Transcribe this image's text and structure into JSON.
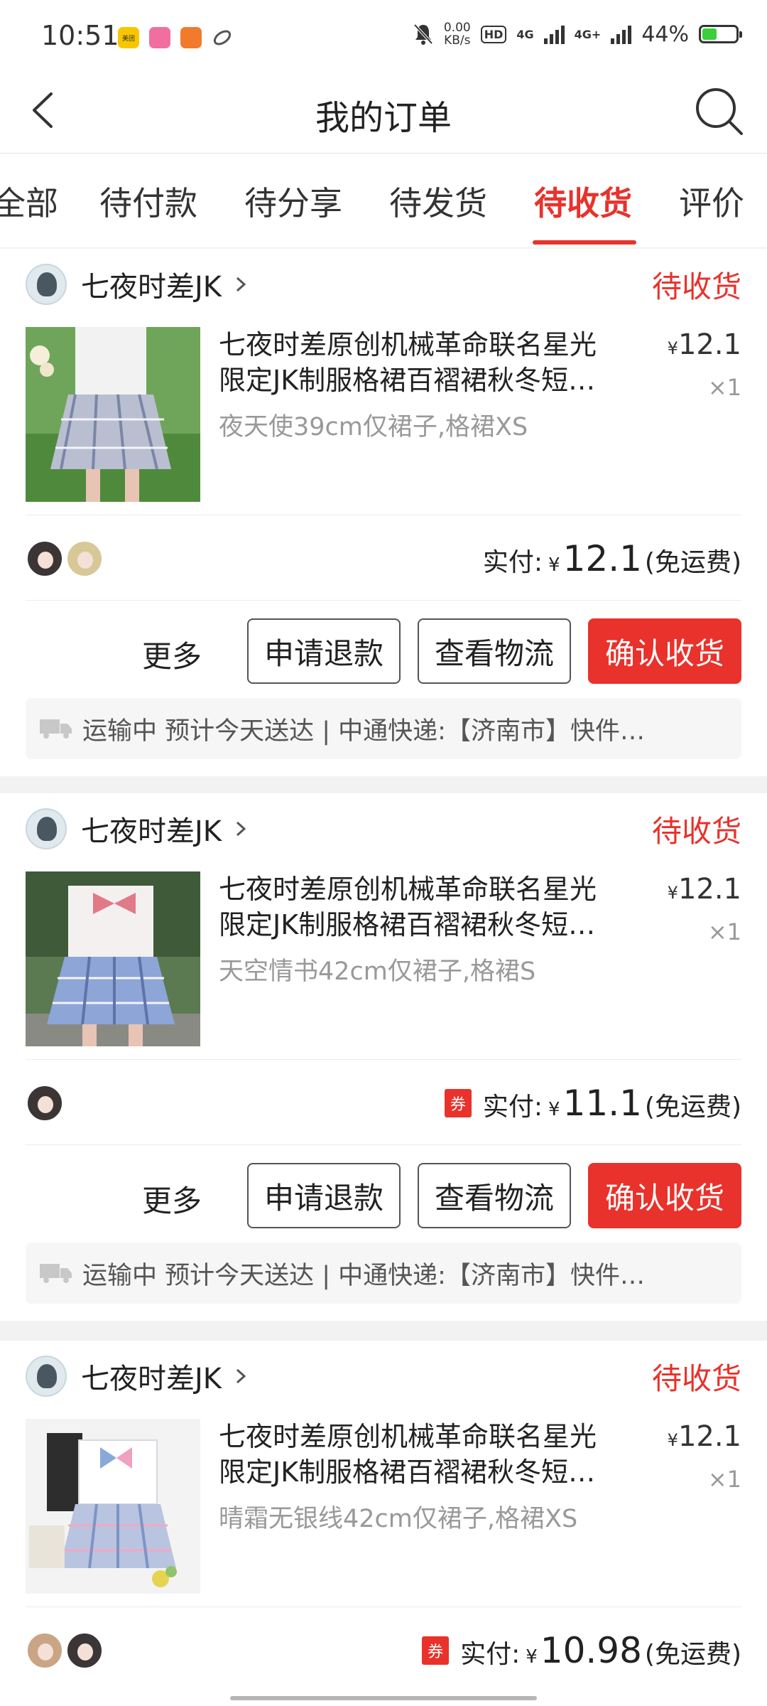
{
  "status_bar": {
    "time": "10:51",
    "net_speed_value": "0.00",
    "net_speed_unit": "KB/s",
    "hd": "HD",
    "network_1": "4G",
    "network_2": "4G+",
    "battery": "44%",
    "battery_level": 0.44,
    "apps": [
      {
        "name": "meituan-icon",
        "label": "美团",
        "color": "#f7c600"
      },
      {
        "name": "bilibili-icon",
        "label": "",
        "color": "#f06fa0"
      },
      {
        "name": "taobao-icon",
        "label": "",
        "color": "#f27a2c"
      },
      {
        "name": "sync-icon",
        "label": "",
        "color": "#555555"
      }
    ]
  },
  "header": {
    "title": "我的订单"
  },
  "tabs": [
    {
      "label": "全部",
      "active": false
    },
    {
      "label": "待付款",
      "active": false
    },
    {
      "label": "待分享",
      "active": false
    },
    {
      "label": "待发货",
      "active": false
    },
    {
      "label": "待收货",
      "active": true
    },
    {
      "label": "评价",
      "active": false
    }
  ],
  "orders": [
    {
      "shop_name": "七夜时差JK",
      "status": "待收货",
      "product_title_line1": "七夜时差原创机械革命联名星光",
      "product_title_line2": "限定JK制服格裙百褶裙秋冬短…",
      "spec": "夜天使39cm仅裙子,格裙XS",
      "price_symbol": "¥",
      "price": "12.1",
      "qty": "×1",
      "has_coupon": false,
      "paid_label": "实付:",
      "paid_symbol": "¥",
      "paid_amount": "12.1",
      "paid_note": "(免运费)",
      "more_label": "更多",
      "refund_label": "申请退款",
      "logistics_label": "查看物流",
      "confirm_label": "确认收货",
      "logistics_text": "运输中 预计今天送达 | 中通快递:【济南市】快件…"
    },
    {
      "shop_name": "七夜时差JK",
      "status": "待收货",
      "product_title_line1": "七夜时差原创机械革命联名星光",
      "product_title_line2": "限定JK制服格裙百褶裙秋冬短…",
      "spec": "天空情书42cm仅裙子,格裙S",
      "price_symbol": "¥",
      "price": "12.1",
      "qty": "×1",
      "has_coupon": true,
      "coupon_label": "券",
      "paid_label": "实付:",
      "paid_symbol": "¥",
      "paid_amount": "11.1",
      "paid_note": "(免运费)",
      "more_label": "更多",
      "refund_label": "申请退款",
      "logistics_label": "查看物流",
      "confirm_label": "确认收货",
      "logistics_text": "运输中 预计今天送达 | 中通快递:【济南市】快件…"
    },
    {
      "shop_name": "七夜时差JK",
      "status": "待收货",
      "product_title_line1": "七夜时差原创机械革命联名星光",
      "product_title_line2": "限定JK制服格裙百褶裙秋冬短…",
      "spec": "晴霜无银线42cm仅裙子,格裙XS",
      "price_symbol": "¥",
      "price": "12.1",
      "qty": "×1",
      "has_coupon": true,
      "coupon_label": "券",
      "paid_label": "实付:",
      "paid_symbol": "¥",
      "paid_amount": "10.98",
      "paid_note": "(免运费)"
    }
  ],
  "colors": {
    "accent": "#e8322b",
    "text": "#222222",
    "muted": "#999999",
    "background": "#f2f2f2"
  }
}
